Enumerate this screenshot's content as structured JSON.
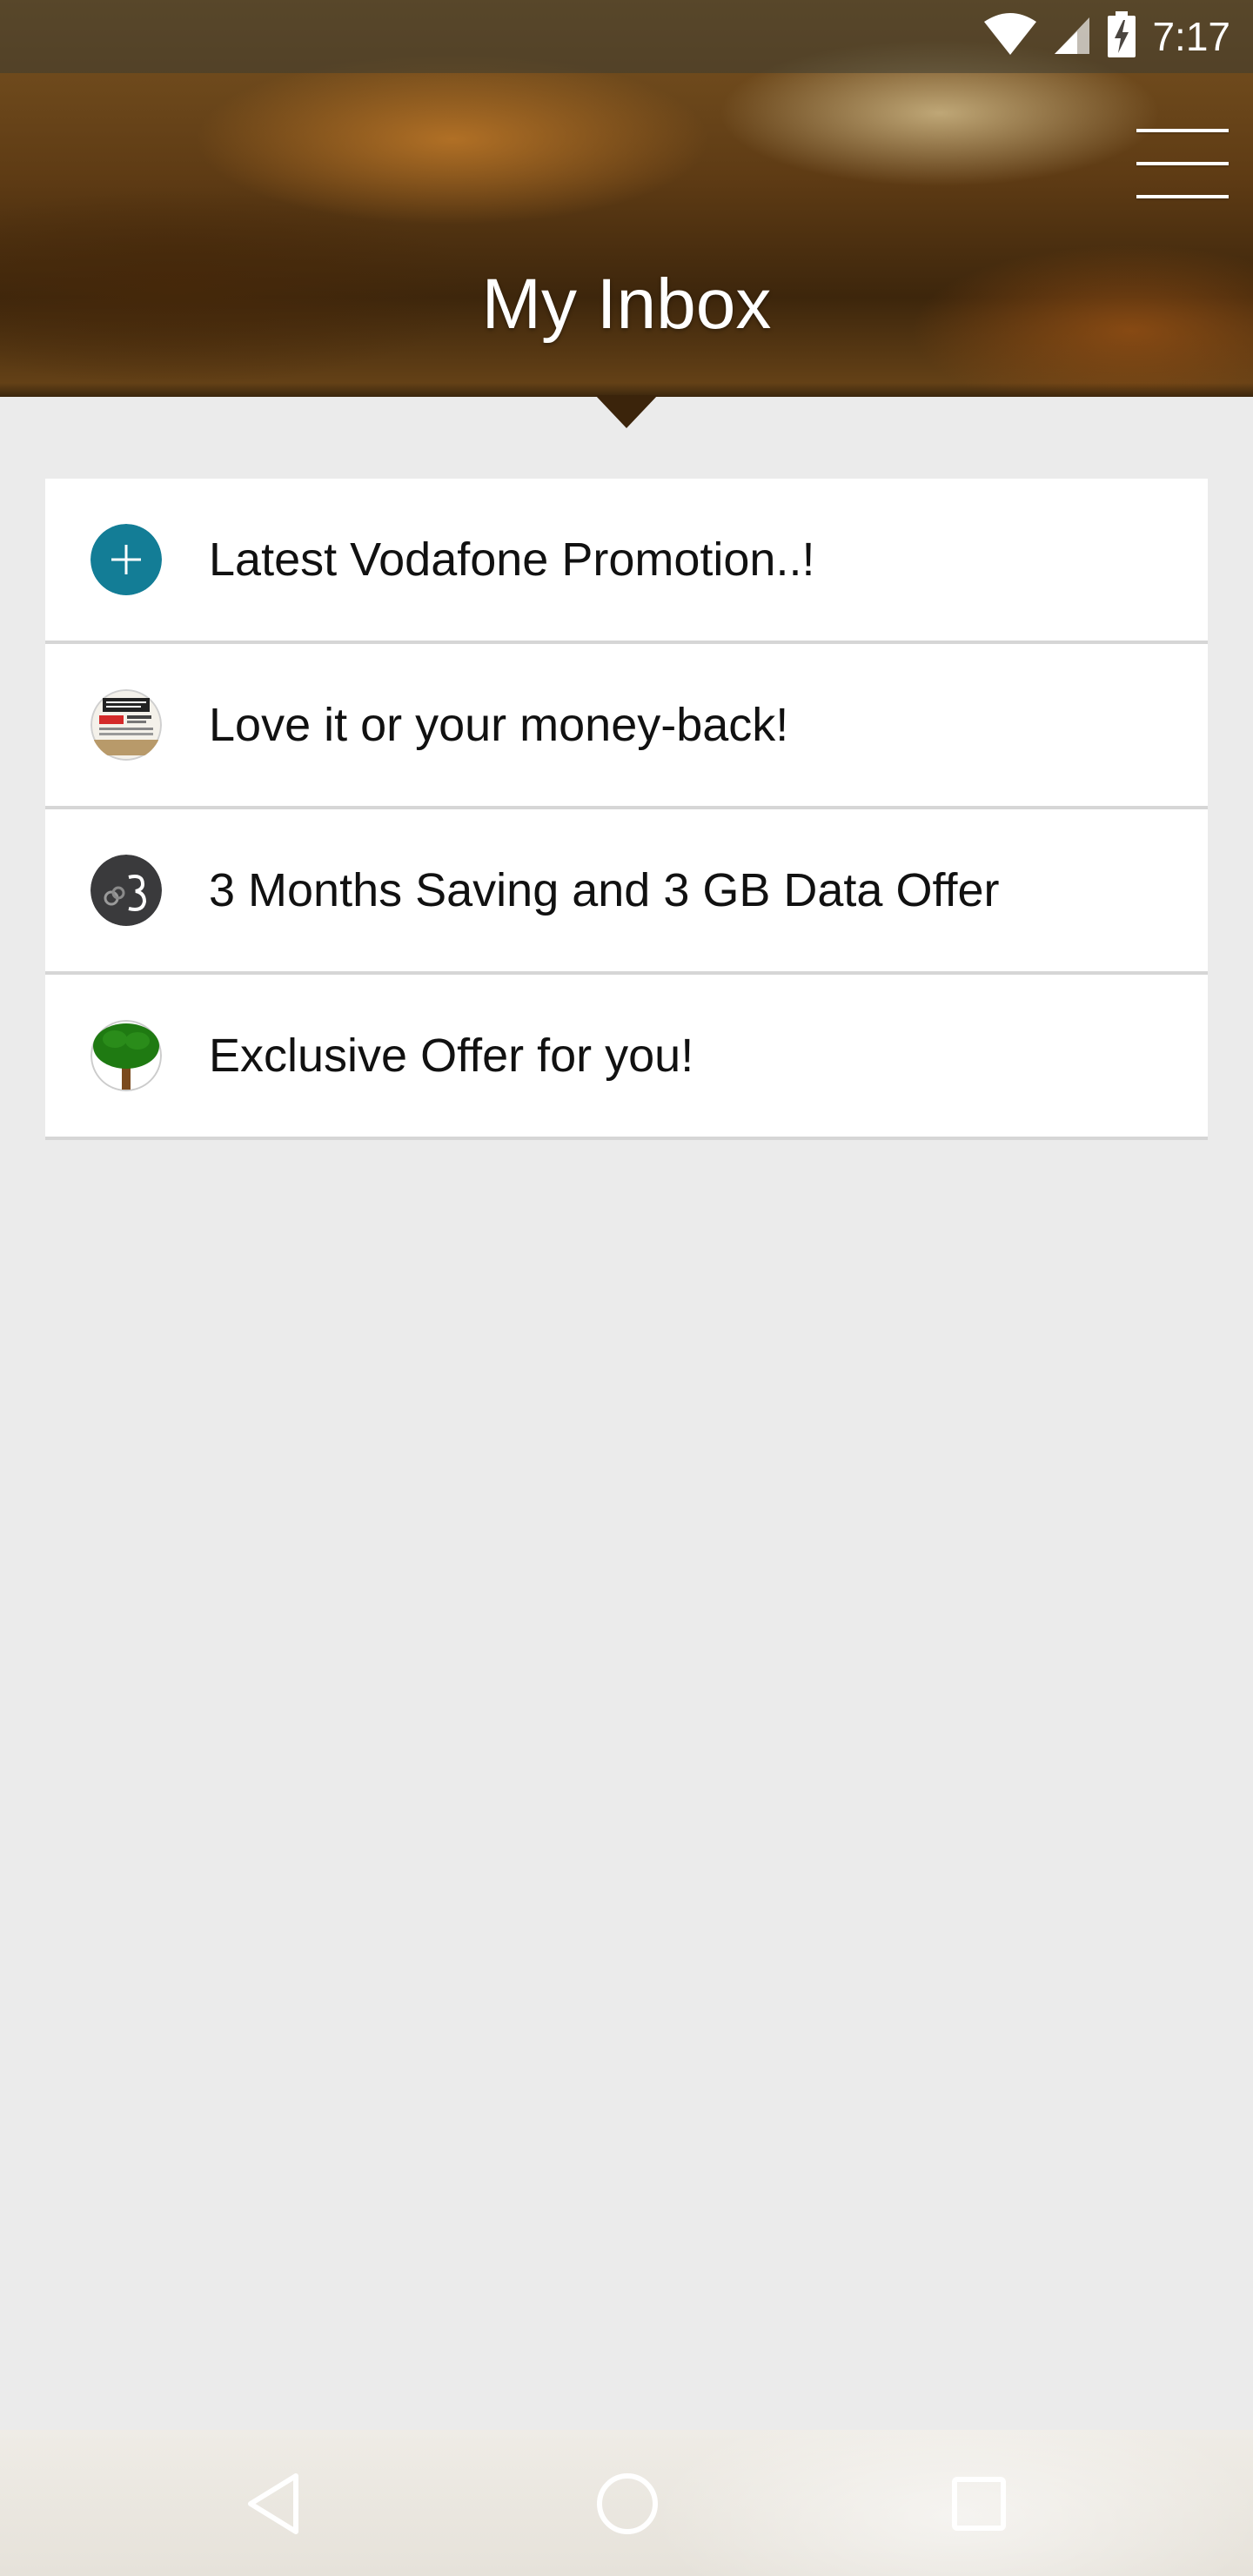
{
  "status_bar": {
    "time": "7:17",
    "icons": [
      "wifi-icon",
      "cell-signal-icon",
      "battery-charging-icon"
    ]
  },
  "header": {
    "title": "My Inbox",
    "menu_icon": "hamburger-menu-icon"
  },
  "inbox": {
    "items": [
      {
        "label": "Latest Vodafone Promotion..!",
        "icon": "plus-circle-icon",
        "icon_color": "#137d96"
      },
      {
        "label": "Love it or your money-back!",
        "icon": "promo-thumbnail-icon"
      },
      {
        "label": "3 Months Saving and 3 GB Data Offer",
        "icon": "chalkboard-three-icon"
      },
      {
        "label": "Exclusive Offer for you!",
        "icon": "tree-icon"
      }
    ]
  },
  "navigation": {
    "back_icon": "back-triangle-icon",
    "home_icon": "home-circle-icon",
    "recents_icon": "recents-square-icon"
  }
}
